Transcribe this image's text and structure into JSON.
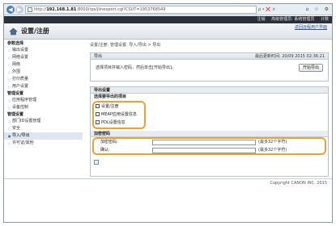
{
  "browser": {
    "back_icon": "back-arrow-icon",
    "forward_icon": "forward-arrow-icon",
    "url_host": "192.168.1.81",
    "url_rest": ":8000/rps/jlinexport.cgi?CSUT=1953768549",
    "addr_tools": "ρ • ❌ ×",
    "win_tools": [
      "⌂",
      "☆",
      "⚙"
    ]
  },
  "topbar": {
    "links": [
      "注销",
      "高级管理员: 系统管理员",
      "计数"
    ]
  },
  "header": {
    "title": "设置/注册",
    "link": "返回远程用户界面"
  },
  "sidebar": {
    "sections": [
      {
        "title": "参数选择",
        "items": [
          "输出设置",
          "网络设置",
          "网络",
          "外围",
          "打印质量",
          "用户设置"
        ]
      },
      {
        "title": "管理设置",
        "items": [
          "应用程序管理",
          "设备控制"
        ]
      },
      {
        "title": "管理设置",
        "items": [
          "部门ID设置管理",
          "安全",
          "导入/导出",
          "许可证/其他"
        ]
      }
    ],
    "active_item": "导入/导出"
  },
  "main": {
    "breadcrumb": "设置/注册: 管理设置: 导入/导出 > 导出",
    "panel_title": "导出",
    "updated": "最后更新时间: 20/09 2015 02:36:21",
    "instruction": "选择项目并输入密码，然后单击[开始导出]。",
    "start_button": "开始导出",
    "export_section": "导出设置",
    "items_section": "选择要导出的项目",
    "checkboxes": [
      "设置/注册",
      "MEAP应用设置信息",
      "PDL设置信息"
    ],
    "password_section": "加密密码",
    "password_label": "加密密码:",
    "password_hint": "(最多32个字符)",
    "confirm_label": "确认:",
    "confirm_hint": "(最多32个字符)"
  },
  "footer": {
    "copyright": "Copyright CANON INC. 2015"
  },
  "colors": {
    "highlight": "#f0a030",
    "topbar": "#2b2f3a"
  }
}
